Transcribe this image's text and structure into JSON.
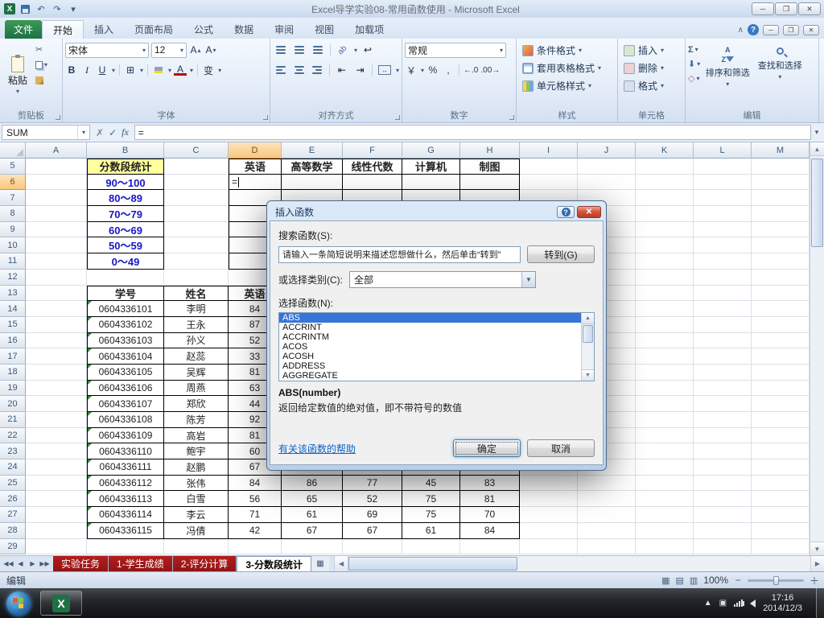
{
  "titlebar": {
    "title": "Excel导学实验08-常用函数使用 - Microsoft Excel"
  },
  "ribbon": {
    "file_tab": "文件",
    "tabs": [
      "开始",
      "插入",
      "页面布局",
      "公式",
      "数据",
      "审阅",
      "视图",
      "加载项"
    ],
    "active_tab": "开始",
    "clipboard": {
      "label": "剪贴板",
      "paste": "粘贴"
    },
    "font": {
      "label": "字体",
      "name": "宋体",
      "size": "12"
    },
    "alignment": {
      "label": "对齐方式"
    },
    "number": {
      "label": "数字",
      "format": "常规"
    },
    "styles": {
      "label": "样式",
      "items": [
        "条件格式",
        "套用表格格式",
        "单元格样式"
      ]
    },
    "cells": {
      "label": "单元格",
      "items": [
        "插入",
        "删除",
        "格式"
      ]
    },
    "editing": {
      "label": "编辑",
      "items": [
        "排序和筛选",
        "查找和选择"
      ]
    }
  },
  "formula_bar": {
    "name_box": "SUM",
    "formula": "="
  },
  "grid": {
    "col_headers": [
      "A",
      "B",
      "C",
      "D",
      "E",
      "F",
      "G",
      "H",
      "I",
      "J",
      "K",
      "L",
      "M"
    ],
    "active_col": "D",
    "active_row": 6,
    "rows": [
      {
        "n": 5,
        "cells": [
          [
            "B",
            "分数段统计",
            "t"
          ],
          [
            "D",
            "英语",
            "h"
          ],
          [
            "E",
            "高等数学",
            "h"
          ],
          [
            "F",
            "线性代数",
            "h"
          ],
          [
            "G",
            "计算机",
            "h"
          ],
          [
            "H",
            "制图",
            "h"
          ]
        ]
      },
      {
        "n": 6,
        "cells": [
          [
            "B",
            "90～100",
            "r"
          ],
          [
            "D",
            "=",
            "e"
          ]
        ]
      },
      {
        "n": 7,
        "cells": [
          [
            "B",
            "80～89",
            "r"
          ]
        ]
      },
      {
        "n": 8,
        "cells": [
          [
            "B",
            "70～79",
            "r"
          ]
        ]
      },
      {
        "n": 9,
        "cells": [
          [
            "B",
            "60～69",
            "r"
          ]
        ]
      },
      {
        "n": 10,
        "cells": [
          [
            "B",
            "50～59",
            "r"
          ]
        ]
      },
      {
        "n": 11,
        "cells": [
          [
            "B",
            "0～49",
            "r"
          ]
        ]
      },
      {
        "n": 12,
        "cells": []
      },
      {
        "n": 13,
        "cells": [
          [
            "B",
            "学号",
            "h"
          ],
          [
            "C",
            "姓名",
            "h"
          ],
          [
            "D",
            "英语",
            "h"
          ]
        ]
      },
      {
        "n": 14,
        "cells": [
          [
            "B",
            "0604336101",
            "d"
          ],
          [
            "C",
            "李明",
            "d"
          ],
          [
            "D",
            "84",
            "d"
          ]
        ]
      },
      {
        "n": 15,
        "cells": [
          [
            "B",
            "0604336102",
            "d"
          ],
          [
            "C",
            "王永",
            "d"
          ],
          [
            "D",
            "87",
            "d"
          ]
        ]
      },
      {
        "n": 16,
        "cells": [
          [
            "B",
            "0604336103",
            "d"
          ],
          [
            "C",
            "孙义",
            "d"
          ],
          [
            "D",
            "52",
            "d"
          ]
        ]
      },
      {
        "n": 17,
        "cells": [
          [
            "B",
            "0604336104",
            "d"
          ],
          [
            "C",
            "赵蕊",
            "d"
          ],
          [
            "D",
            "33",
            "d"
          ]
        ]
      },
      {
        "n": 18,
        "cells": [
          [
            "B",
            "0604336105",
            "d"
          ],
          [
            "C",
            "吴辉",
            "d"
          ],
          [
            "D",
            "81",
            "d"
          ]
        ]
      },
      {
        "n": 19,
        "cells": [
          [
            "B",
            "0604336106",
            "d"
          ],
          [
            "C",
            "周燕",
            "d"
          ],
          [
            "D",
            "63",
            "d"
          ]
        ]
      },
      {
        "n": 20,
        "cells": [
          [
            "B",
            "0604336107",
            "d"
          ],
          [
            "C",
            "郑欣",
            "d"
          ],
          [
            "D",
            "44",
            "d"
          ]
        ]
      },
      {
        "n": 21,
        "cells": [
          [
            "B",
            "0604336108",
            "d"
          ],
          [
            "C",
            "陈芳",
            "d"
          ],
          [
            "D",
            "92",
            "d"
          ]
        ]
      },
      {
        "n": 22,
        "cells": [
          [
            "B",
            "0604336109",
            "d"
          ],
          [
            "C",
            "高岩",
            "d"
          ],
          [
            "D",
            "81",
            "d"
          ]
        ]
      },
      {
        "n": 23,
        "cells": [
          [
            "B",
            "0604336110",
            "d"
          ],
          [
            "C",
            "鲍宇",
            "d"
          ],
          [
            "D",
            "60",
            "d"
          ]
        ]
      },
      {
        "n": 24,
        "cells": [
          [
            "B",
            "0604336111",
            "d"
          ],
          [
            "C",
            "赵鹏",
            "d"
          ],
          [
            "D",
            "67",
            "d"
          ]
        ]
      },
      {
        "n": 25,
        "cells": [
          [
            "B",
            "0604336112",
            "d"
          ],
          [
            "C",
            "张伟",
            "d"
          ],
          [
            "D",
            "84",
            "d"
          ],
          [
            "E",
            "86",
            "d"
          ],
          [
            "F",
            "77",
            "d"
          ],
          [
            "G",
            "45",
            "d"
          ],
          [
            "H",
            "83",
            "d"
          ]
        ]
      },
      {
        "n": 26,
        "cells": [
          [
            "B",
            "0604336113",
            "d"
          ],
          [
            "C",
            "白雪",
            "d"
          ],
          [
            "D",
            "56",
            "d"
          ],
          [
            "E",
            "65",
            "d"
          ],
          [
            "F",
            "52",
            "d"
          ],
          [
            "G",
            "75",
            "d"
          ],
          [
            "H",
            "81",
            "d"
          ]
        ]
      },
      {
        "n": 27,
        "cells": [
          [
            "B",
            "0604336114",
            "d"
          ],
          [
            "C",
            "李云",
            "d"
          ],
          [
            "D",
            "71",
            "d"
          ],
          [
            "E",
            "61",
            "d"
          ],
          [
            "F",
            "69",
            "d"
          ],
          [
            "G",
            "75",
            "d"
          ],
          [
            "H",
            "70",
            "d"
          ]
        ]
      },
      {
        "n": 28,
        "cells": [
          [
            "B",
            "0604336115",
            "d"
          ],
          [
            "C",
            "冯倩",
            "d"
          ],
          [
            "D",
            "42",
            "d"
          ],
          [
            "E",
            "67",
            "d"
          ],
          [
            "F",
            "67",
            "d"
          ],
          [
            "G",
            "61",
            "d"
          ],
          [
            "H",
            "84",
            "d"
          ]
        ]
      },
      {
        "n": 29,
        "cells": []
      }
    ]
  },
  "dialog": {
    "title": "插入函数",
    "search_label": "搜索函数(S):",
    "search_value": "请输入一条简短说明来描述您想做什么，然后单击“转到”",
    "go_button": "转到(G)",
    "category_label": "或选择类别(C):",
    "category_value": "全部",
    "select_label": "选择函数(N):",
    "functions": [
      "ABS",
      "ACCRINT",
      "ACCRINTM",
      "ACOS",
      "ACOSH",
      "ADDRESS",
      "AGGREGATE"
    ],
    "selected_function": "ABS",
    "signature": "ABS(number)",
    "description": "返回给定数值的绝对值，即不带符号的数值",
    "help_link": "有关该函数的帮助",
    "ok": "确定",
    "cancel": "取消"
  },
  "sheet_bar": {
    "tabs": [
      {
        "label": "实验任务",
        "active": false
      },
      {
        "label": "1-学生成绩",
        "active": false
      },
      {
        "label": "2-评分计算",
        "active": false
      },
      {
        "label": "3-分数段统计",
        "active": true
      }
    ]
  },
  "status_bar": {
    "mode": "编辑",
    "zoom": "100%"
  },
  "taskbar": {
    "time": "17:16",
    "date": "2014/12/3"
  }
}
